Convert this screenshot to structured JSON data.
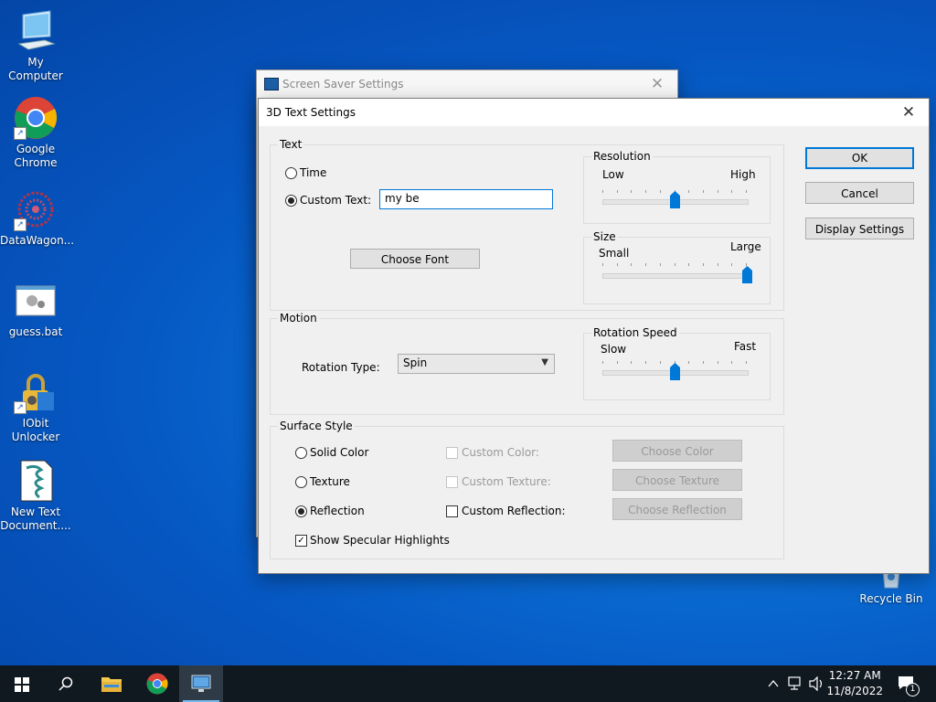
{
  "desktop": {
    "icons": [
      {
        "label": "My Computer",
        "icon": "monitor-icon"
      },
      {
        "label": "Google Chrome",
        "icon": "chrome-icon"
      },
      {
        "label": "DataWagon...",
        "icon": "datawagon-icon"
      },
      {
        "label": "guess.bat",
        "icon": "batch-file-icon"
      },
      {
        "label": "IObit Unlocker",
        "icon": "iobit-unlocker-icon"
      },
      {
        "label": "New Text Document....",
        "icon": "text-document-icon"
      },
      {
        "label": "Recycle Bin",
        "icon": "recycle-bin-icon"
      }
    ]
  },
  "parent_window": {
    "title": "Screen Saver Settings",
    "close": "✕"
  },
  "dialog": {
    "title": "3D Text Settings",
    "close": "✕",
    "text_group": {
      "title": "Text",
      "time_label": "Time",
      "custom_text_label": "Custom Text:",
      "custom_text_value": "my be",
      "selected": "custom_text",
      "choose_font_label": "Choose Font"
    },
    "resolution": {
      "title": "Resolution",
      "low": "Low",
      "high": "High",
      "value": 0.5
    },
    "size": {
      "title": "Size",
      "small": "Small",
      "large": "Large",
      "value": 1.0
    },
    "motion_group": {
      "title": "Motion",
      "rotation_type_label": "Rotation Type:",
      "rotation_type_value": "Spin"
    },
    "rotation_speed": {
      "title": "Rotation Speed",
      "slow": "Slow",
      "fast": "Fast",
      "value": 0.5
    },
    "surface_group": {
      "title": "Surface Style",
      "solid_color_label": "Solid Color",
      "texture_label": "Texture",
      "reflection_label": "Reflection",
      "selected": "reflection",
      "custom_color_label": "Custom Color:",
      "custom_texture_label": "Custom Texture:",
      "custom_reflection_label": "Custom Reflection:",
      "choose_color_label": "Choose Color",
      "choose_texture_label": "Choose Texture",
      "choose_reflection_label": "Choose Reflection",
      "specular_label": "Show Specular Highlights",
      "specular_checked": true
    },
    "ok_label": "OK",
    "cancel_label": "Cancel",
    "display_settings_label": "Display Settings"
  },
  "taskbar": {
    "time": "12:27 AM",
    "date": "11/8/2022",
    "notification_count": "1",
    "accent": "#76b9ed"
  }
}
